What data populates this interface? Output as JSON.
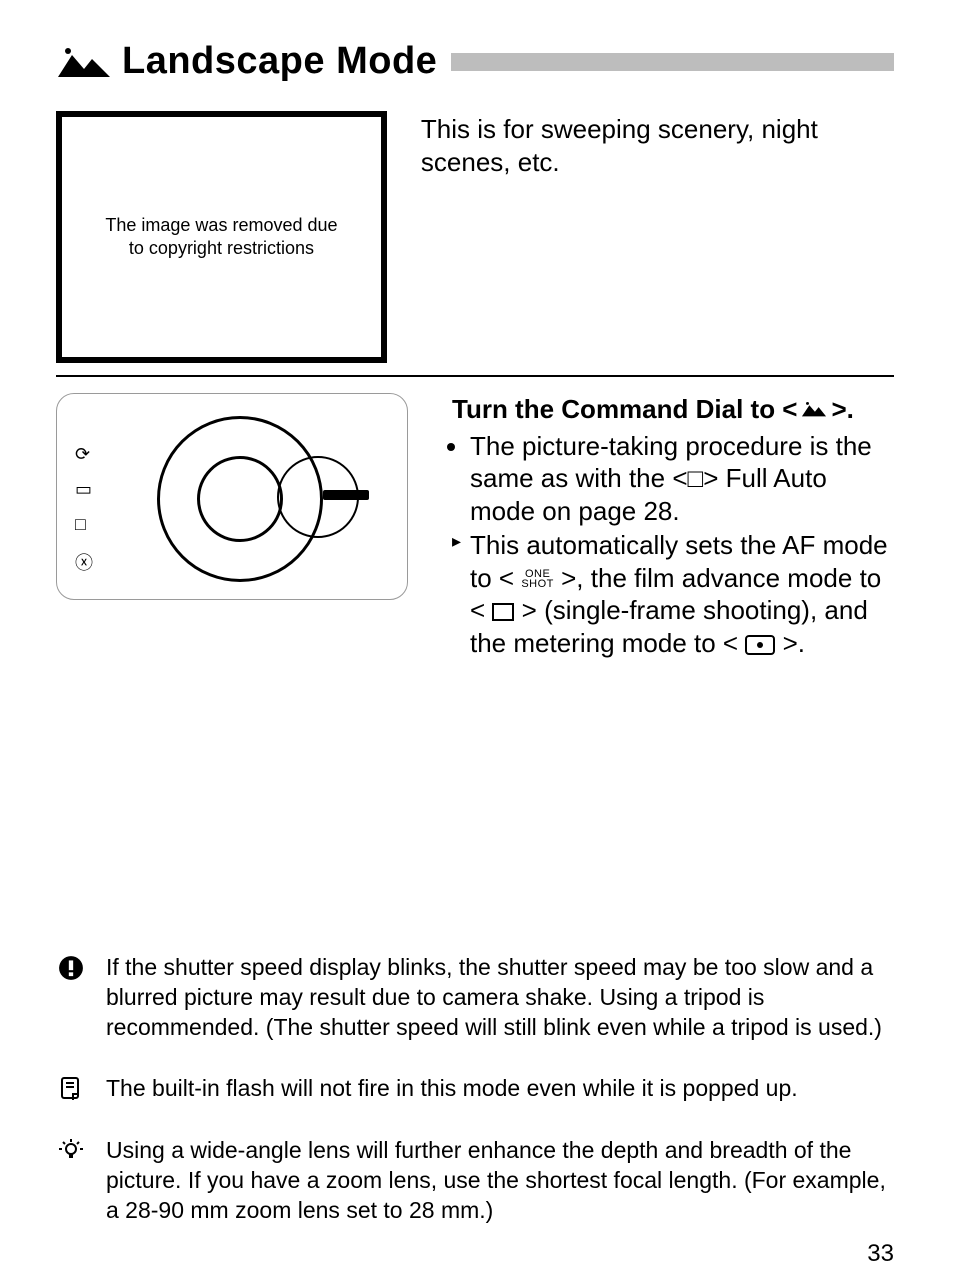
{
  "title": {
    "icon_name": "landscape-icon",
    "text": "Landscape Mode"
  },
  "intro": {
    "image_placeholder_line1": "The image was removed due",
    "image_placeholder_line2": "to copyright restrictions",
    "text": "This is for sweeping scenery, night scenes, etc."
  },
  "step": {
    "heading_prefix": "Turn the Command Dial to <",
    "heading_suffix": ">.",
    "bullets": [
      "The picture-taking procedure is the same as with the <□> Full Auto mode on page 28."
    ],
    "arrow_bullet": {
      "part1": "This automatically sets the AF mode to <",
      "one": "ONE",
      "shot": "SHOT",
      "part2": ">, the film advance mode to <",
      "part3": "> (single-frame shooting), and the metering mode to <",
      "part4": ">."
    }
  },
  "notes": {
    "warning": "If the shutter speed display blinks, the shutter speed may be too slow and a blurred picture may result due to camera shake. Using a tripod is recommended. (The shutter speed will still blink even while a tripod is used.)",
    "info": "The built-in flash will not fire in this mode even while it is popped up.",
    "tip": "Using a wide-angle lens will further enhance the depth and breadth of the picture. If you have a zoom lens, use the shortest focal length. (For example, a 28-90 mm zoom lens set to 28 mm.)"
  },
  "page_number": "33"
}
